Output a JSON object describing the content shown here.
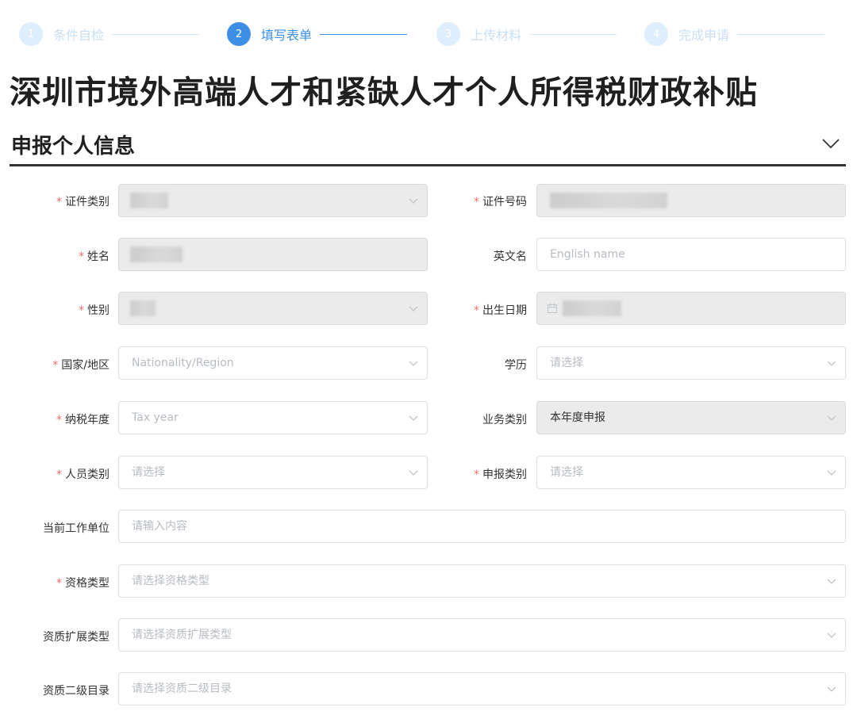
{
  "steps": [
    {
      "num": "1",
      "label": "条件自检",
      "state": "inactive"
    },
    {
      "num": "2",
      "label": "填写表单",
      "state": "active"
    },
    {
      "num": "3",
      "label": "上传材料",
      "state": "inactive"
    },
    {
      "num": "4",
      "label": "完成申请",
      "state": "inactive"
    }
  ],
  "page_title": "深圳市境外高端人才和紧缺人才个人所得税财政补贴",
  "section": {
    "title": "申报个人信息",
    "collapse_icon": "chevron-down-icon"
  },
  "required_mark": "*",
  "form": {
    "id_type": {
      "label": "证件类别",
      "value": ""
    },
    "id_number": {
      "label": "证件号码",
      "value": ""
    },
    "name": {
      "label": "姓名",
      "value": ""
    },
    "english_name": {
      "label": "英文名",
      "placeholder": "English name"
    },
    "gender": {
      "label": "性别",
      "value": ""
    },
    "birth_date": {
      "label": "出生日期",
      "value": ""
    },
    "nationality": {
      "label": "国家/地区",
      "placeholder": "Nationality/Region"
    },
    "education": {
      "label": "学历",
      "placeholder": "请选择"
    },
    "tax_year": {
      "label": "纳税年度",
      "placeholder": "Tax year"
    },
    "business_type": {
      "label": "业务类别",
      "value": "本年度申报"
    },
    "personnel_type": {
      "label": "人员类别",
      "placeholder": "请选择"
    },
    "declaration_type": {
      "label": "申报类别",
      "placeholder": "请选择"
    },
    "employer": {
      "label": "当前工作单位",
      "placeholder": "请输入内容"
    },
    "qualification_type": {
      "label": "资格类型",
      "placeholder": "请选择资格类型"
    },
    "qualification_ext_type": {
      "label": "资质扩展类型",
      "placeholder": "请选择资质扩展类型"
    },
    "qualification_sub_dir": {
      "label": "资质二级目录",
      "placeholder": "请选择资质二级目录"
    }
  }
}
